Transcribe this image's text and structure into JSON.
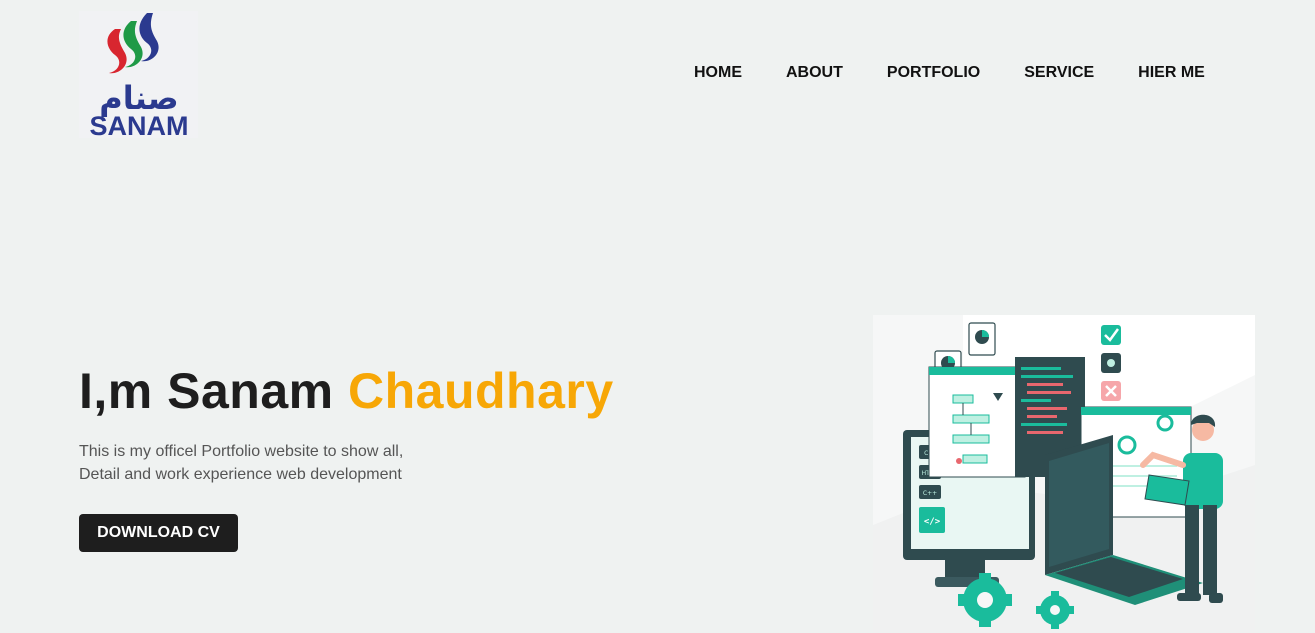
{
  "brand": {
    "logo_text": "SANAM",
    "logo_script": "صنام",
    "colors": {
      "blue": "#2b3a8f",
      "red": "#d8262f",
      "green": "#1f9a46"
    }
  },
  "nav": {
    "items": [
      {
        "label": "HOME"
      },
      {
        "label": "ABOUT"
      },
      {
        "label": "PORTFOLIO"
      },
      {
        "label": "SERVICE"
      },
      {
        "label": "HIER ME"
      }
    ]
  },
  "hero": {
    "title_prefix": "I,m Sanam ",
    "title_accent": "Chaudhary",
    "accent_color": "#f7a706",
    "description_line1": "This is my officel Portfolio website to show all,",
    "description_line2": "Detail and work experience web development",
    "cta_label": "DOWNLOAD CV"
  },
  "illustration": {
    "name": "web-developer-illustration",
    "labels": [
      "CSS",
      "HTML",
      "C++",
      "</>"
    ],
    "colors": {
      "teal": "#1abc9c",
      "dark": "#2f4b4f",
      "light": "#bff0e2"
    }
  }
}
